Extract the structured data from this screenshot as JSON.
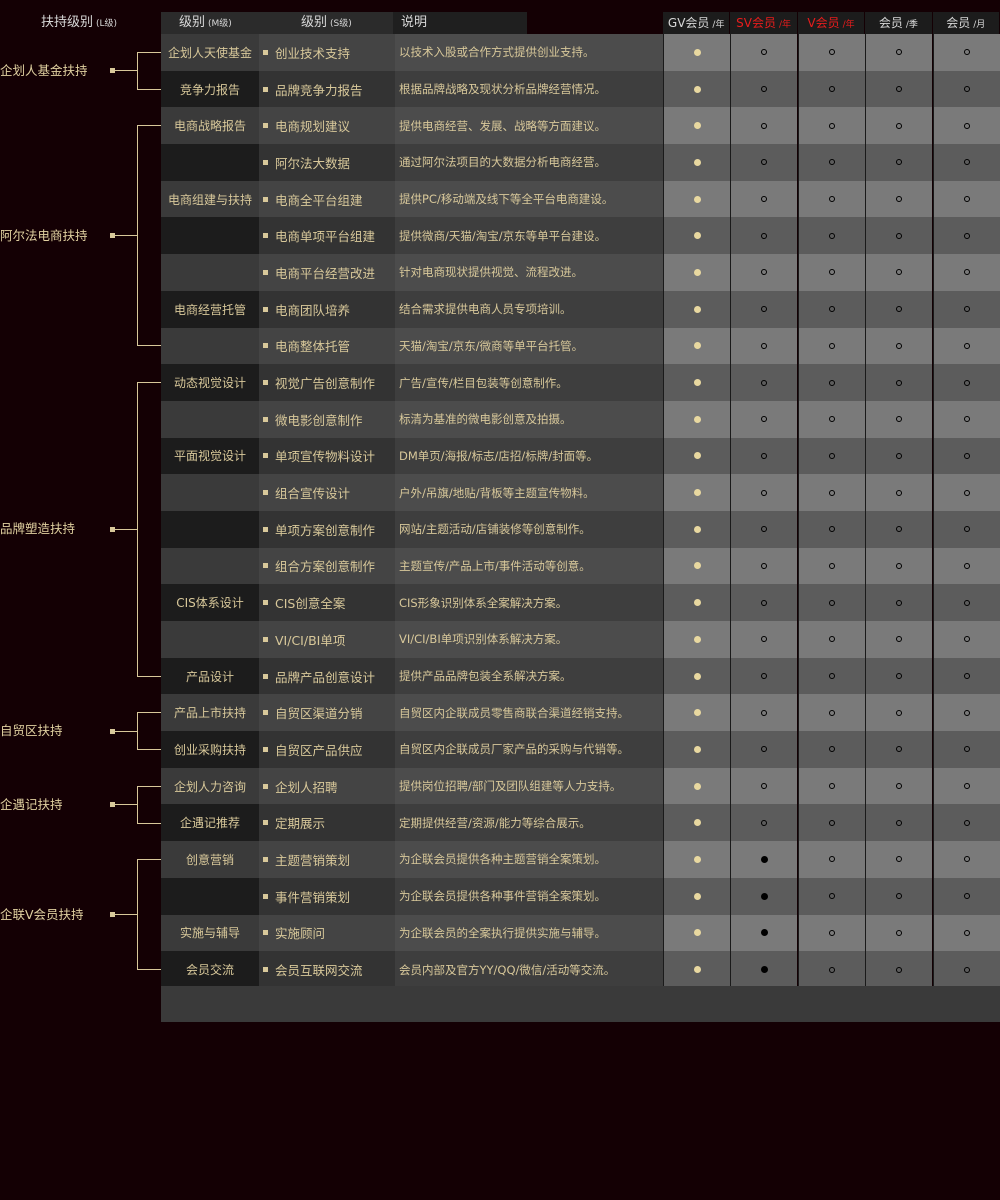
{
  "header": {
    "l_label": "扶持级别",
    "l_sub": "(L级)",
    "m_label": "级别",
    "m_sub": "(M级)",
    "s_label": "级别",
    "s_sub": "(S级)",
    "desc_label": "说明",
    "members": [
      {
        "name": "GV会员",
        "unit": "/年",
        "color": "#d8d8d8"
      },
      {
        "name": "SV会员",
        "unit": "/年",
        "color": "#e81c1c"
      },
      {
        "name": "V会员",
        "unit": "/年",
        "color": "#e81c1c"
      },
      {
        "name": "会员",
        "unit": "/季",
        "color": "#d8d8d8"
      },
      {
        "name": "会员",
        "unit": "/月",
        "color": "#d8d8d8"
      }
    ]
  },
  "colors": {
    "page_bg": "#140004",
    "gold": "#d8c89a",
    "member_col_light": "#7a7a7a",
    "member_col_dark": "#5c5c5c",
    "red_header": "#e81c1c"
  },
  "l_groups": [
    {
      "label": "企划人基金扶持",
      "start": 0,
      "end": 1
    },
    {
      "label": "阿尔法电商扶持",
      "start": 2,
      "end": 8
    },
    {
      "label": "品牌塑造扶持",
      "start": 9,
      "end": 17
    },
    {
      "label": "自贸区扶持",
      "start": 18,
      "end": 19
    },
    {
      "label": "企遇记扶持",
      "start": 20,
      "end": 21
    },
    {
      "label": "企联V会员扶持",
      "start": 22,
      "end": 25
    }
  ],
  "rows": [
    {
      "m": "企划人天使基金",
      "s": "创业技术支持",
      "d": "以技术入股或合作方式提供创业支持。",
      "mem": [
        "gold",
        "open",
        "open",
        "open",
        "open"
      ]
    },
    {
      "m": "竞争力报告",
      "s": "品牌竞争力报告",
      "d": "根据品牌战略及现状分析品牌经营情况。",
      "mem": [
        "gold",
        "open",
        "open",
        "open",
        "open"
      ]
    },
    {
      "m": "电商战略报告",
      "s": "电商规划建议",
      "d": "提供电商经营、发展、战略等方面建议。",
      "mem": [
        "gold",
        "open",
        "open",
        "open",
        "open"
      ]
    },
    {
      "m": "",
      "s": "阿尔法大数据",
      "d": "通过阿尔法项目的大数据分析电商经营。",
      "mem": [
        "gold",
        "open",
        "open",
        "open",
        "open"
      ]
    },
    {
      "m": "电商组建与扶持",
      "s": "电商全平台组建",
      "d": "提供PC/移动端及线下等全平台电商建设。",
      "mem": [
        "gold",
        "open",
        "open",
        "open",
        "open"
      ]
    },
    {
      "m": "",
      "s": "电商单项平台组建",
      "d": "提供微商/天猫/淘宝/京东等单平台建设。",
      "mem": [
        "gold",
        "open",
        "open",
        "open",
        "open"
      ]
    },
    {
      "m": "",
      "s": "电商平台经营改进",
      "d": "针对电商现状提供视觉、流程改进。",
      "mem": [
        "gold",
        "open",
        "open",
        "open",
        "open"
      ]
    },
    {
      "m": "电商经营托管",
      "s": "电商团队培养",
      "d": "结合需求提供电商人员专项培训。",
      "mem": [
        "gold",
        "open",
        "open",
        "open",
        "open"
      ]
    },
    {
      "m": "",
      "s": "电商整体托管",
      "d": "天猫/淘宝/京东/微商等单平台托管。",
      "mem": [
        "gold",
        "open",
        "open",
        "open",
        "open"
      ]
    },
    {
      "m": "动态视觉设计",
      "s": "视觉广告创意制作",
      "d": "广告/宣传/栏目包装等创意制作。",
      "mem": [
        "gold",
        "open",
        "open",
        "open",
        "open"
      ]
    },
    {
      "m": "",
      "s": "微电影创意制作",
      "d": "标清为基准的微电影创意及拍摄。",
      "mem": [
        "gold",
        "open",
        "open",
        "open",
        "open"
      ]
    },
    {
      "m": "平面视觉设计",
      "s": "单项宣传物料设计",
      "d": "DM单页/海报/标志/店招/标牌/封面等。",
      "mem": [
        "gold",
        "open",
        "open",
        "open",
        "open"
      ]
    },
    {
      "m": "",
      "s": "组合宣传设计",
      "d": "户外/吊旗/地贴/背板等主题宣传物料。",
      "mem": [
        "gold",
        "open",
        "open",
        "open",
        "open"
      ]
    },
    {
      "m": "",
      "s": "单项方案创意制作",
      "d": "网站/主题活动/店铺装修等创意制作。",
      "mem": [
        "gold",
        "open",
        "open",
        "open",
        "open"
      ]
    },
    {
      "m": "",
      "s": "组合方案创意制作",
      "d": "主题宣传/产品上市/事件活动等创意。",
      "mem": [
        "gold",
        "open",
        "open",
        "open",
        "open"
      ]
    },
    {
      "m": "CIS体系设计",
      "s": "CIS创意全案",
      "d": "CIS形象识别体系全案解决方案。",
      "mem": [
        "gold",
        "open",
        "open",
        "open",
        "open"
      ]
    },
    {
      "m": "",
      "s": "VI/CI/BI单项",
      "d": "VI/CI/BI单项识别体系解决方案。",
      "mem": [
        "gold",
        "open",
        "open",
        "open",
        "open"
      ]
    },
    {
      "m": "产品设计",
      "s": "品牌产品创意设计",
      "d": "提供产品品牌包装全系解决方案。",
      "mem": [
        "gold",
        "open",
        "open",
        "open",
        "open"
      ]
    },
    {
      "m": "产品上市扶持",
      "s": "自贸区渠道分销",
      "d": "自贸区内企联成员零售商联合渠道经销支持。",
      "mem": [
        "gold",
        "open",
        "open",
        "open",
        "open"
      ]
    },
    {
      "m": "创业采购扶持",
      "s": "自贸区产品供应",
      "d": "自贸区内企联成员厂家产品的采购与代销等。",
      "mem": [
        "gold",
        "open",
        "open",
        "open",
        "open"
      ]
    },
    {
      "m": "企划人力咨询",
      "s": "企划人招聘",
      "d": "提供岗位招聘/部门及团队组建等人力支持。",
      "mem": [
        "gold",
        "open",
        "open",
        "open",
        "open"
      ]
    },
    {
      "m": "企遇记推荐",
      "s": "定期展示",
      "d": "定期提供经营/资源/能力等综合展示。",
      "mem": [
        "gold",
        "open",
        "open",
        "open",
        "open"
      ]
    },
    {
      "m": "创意营销",
      "s": "主题营销策划",
      "d": "为企联会员提供各种主题营销全案策划。",
      "mem": [
        "gold",
        "black",
        "open",
        "open",
        "open"
      ]
    },
    {
      "m": "",
      "s": "事件营销策划",
      "d": "为企联会员提供各种事件营销全案策划。",
      "mem": [
        "gold",
        "black",
        "open",
        "open",
        "open"
      ]
    },
    {
      "m": "实施与辅导",
      "s": "实施顾问",
      "d": "为企联会员的全案执行提供实施与辅导。",
      "mem": [
        "gold",
        "black",
        "open",
        "open",
        "open"
      ]
    },
    {
      "m": "会员交流",
      "s": "会员互联网交流",
      "d": "会员内部及官方YY/QQ/微信/活动等交流。",
      "mem": [
        "gold",
        "black",
        "open",
        "open",
        "open"
      ]
    }
  ]
}
